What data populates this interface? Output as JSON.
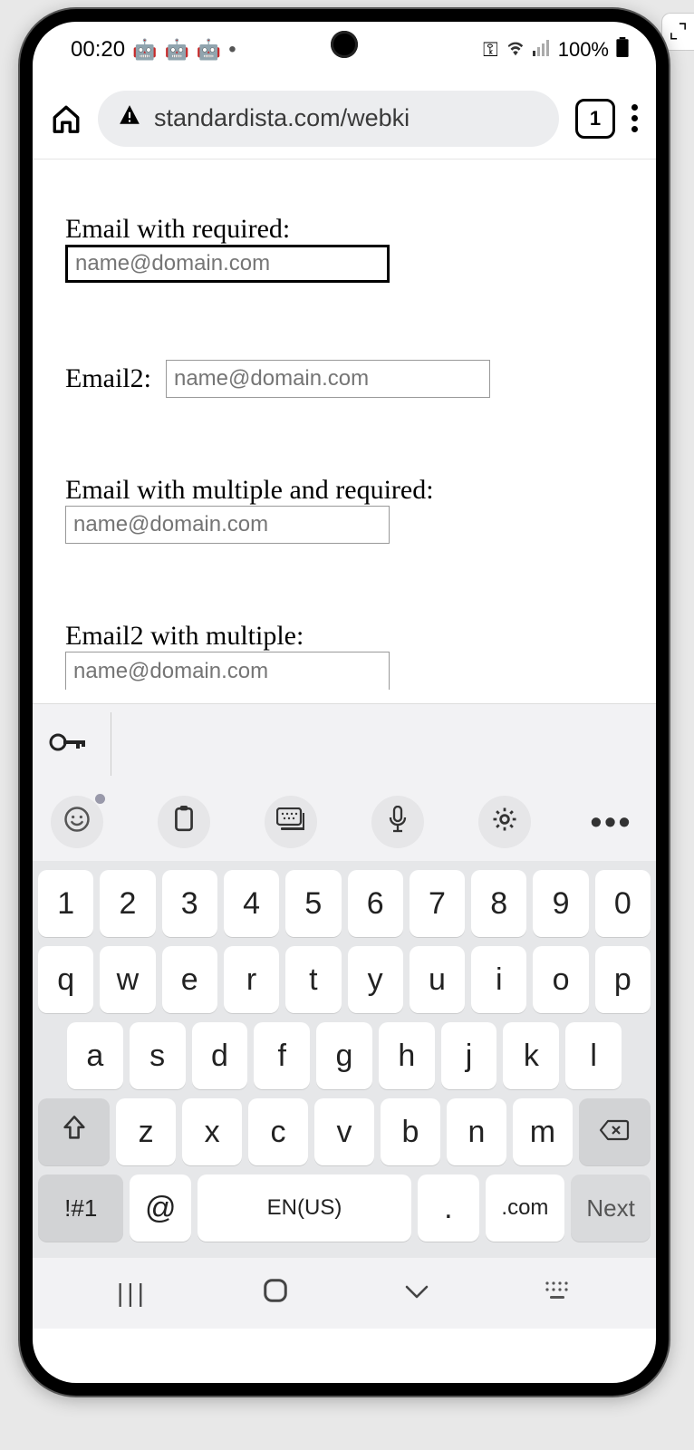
{
  "status": {
    "time": "00:20",
    "battery": "100%"
  },
  "browser": {
    "url": "standardista.com/webki",
    "tab_count": "1"
  },
  "form": {
    "f1": {
      "label": "Email with required:",
      "placeholder": "name@domain.com"
    },
    "f2": {
      "label": "Email2:",
      "placeholder": "name@domain.com"
    },
    "f3": {
      "label": "Email with multiple and required:",
      "placeholder": "name@domain.com"
    },
    "f4": {
      "label": "Email2 with multiple:",
      "placeholder": "name@domain.com"
    }
  },
  "keyboard": {
    "row1": [
      "1",
      "2",
      "3",
      "4",
      "5",
      "6",
      "7",
      "8",
      "9",
      "0"
    ],
    "row2": [
      "q",
      "w",
      "e",
      "r",
      "t",
      "y",
      "u",
      "i",
      "o",
      "p"
    ],
    "row3": [
      "a",
      "s",
      "d",
      "f",
      "g",
      "h",
      "j",
      "k",
      "l"
    ],
    "row4": [
      "z",
      "x",
      "c",
      "v",
      "b",
      "n",
      "m"
    ],
    "bottom": {
      "sym": "!#1",
      "at": "@",
      "space": "EN(US)",
      "dot": ".",
      "com": ".com",
      "next": "Next"
    }
  },
  "icons": {
    "shift": "⇧",
    "backspace": "⌫",
    "emoji": "☺",
    "clipboard": "▢",
    "kbswitch": "⌨",
    "mic": "🎙",
    "gear": "⚙",
    "more": "⋯",
    "key": "⚿",
    "recent": "|||",
    "home": "▢",
    "down": "∨",
    "kbmini": "⠿"
  }
}
